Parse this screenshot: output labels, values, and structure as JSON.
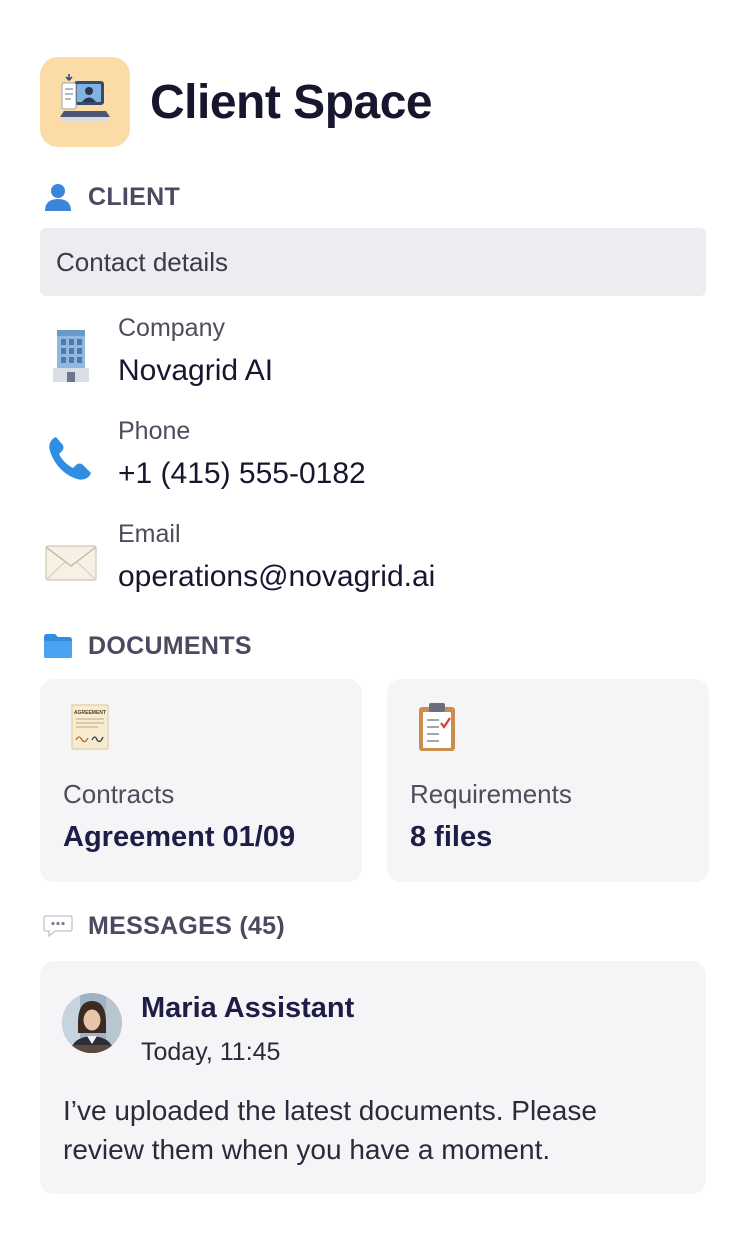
{
  "app": {
    "title": "Client Space",
    "icon": "workspace-computer-icon",
    "accent_color": "#fbdca6"
  },
  "client_section": {
    "heading": "CLIENT",
    "icon": "person-icon",
    "bar_label": "Contact details",
    "details": [
      {
        "icon": "office-building-icon",
        "label": "Company",
        "value": "Novagrid AI"
      },
      {
        "icon": "phone-icon",
        "label": "Phone",
        "value": "+1 (415) 555-0182"
      },
      {
        "icon": "envelope-icon",
        "label": "Email",
        "value": "operations@novagrid.ai"
      }
    ]
  },
  "documents_section": {
    "heading": "DOCUMENTS",
    "icon": "folder-icon",
    "cards": [
      {
        "icon": "agreement-document-icon",
        "icon_text": "AGREEMENT",
        "label": "Contracts",
        "value": "Agreement 01/09"
      },
      {
        "icon": "clipboard-checklist-icon",
        "label": "Requirements",
        "value": "8 files"
      }
    ]
  },
  "messages_section": {
    "heading": "MESSAGES (45)",
    "icon": "speech-bubble-icon",
    "message": {
      "sender": "Maria Assistant",
      "time": "Today, 11:45",
      "text": "I’ve uploaded the latest documents. Please review them when you have a moment.",
      "avatar": "avatar"
    }
  }
}
